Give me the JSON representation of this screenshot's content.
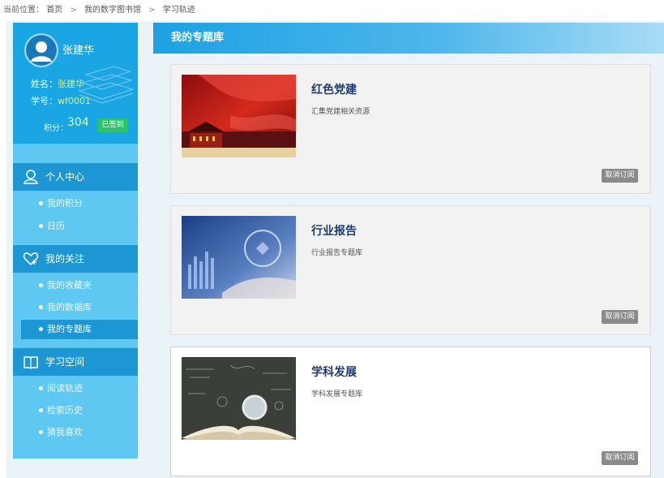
{
  "breadcrumb": {
    "prefix": "当前位置：",
    "items": [
      "首页",
      "我的数字图书馆",
      "学习轨迹"
    ],
    "separator": ">"
  },
  "profile": {
    "name": "张建华",
    "name_label": "姓名：",
    "name_value": "张建华",
    "id_label": "学号：",
    "id_value": "wf0001",
    "score_label": "积分：",
    "score_value": "304",
    "checkin_label": "已签到"
  },
  "sidebar": {
    "groups": [
      {
        "title": "个人中心",
        "icon": "person-icon",
        "items": [
          "我的积分",
          "日历"
        ]
      },
      {
        "title": "我的关注",
        "icon": "heart-plus-icon",
        "items": [
          "我的收藏夹",
          "我的数据库",
          "我的专题库"
        ]
      },
      {
        "title": "学习空间",
        "icon": "book-icon",
        "items": [
          "阅读轨迹",
          "检索历史",
          "猜我喜欢"
        ]
      }
    ],
    "active_item": "我的专题库"
  },
  "main": {
    "title": "我的专题库",
    "cards": [
      {
        "title": "红色党建",
        "desc": "汇集党建相关资源",
        "button": "取消订阅"
      },
      {
        "title": "行业报告",
        "desc": "行业报告专题库",
        "button": "取消订阅"
      },
      {
        "title": "学科发展",
        "desc": "学科发展专题库",
        "button": "取消订阅"
      }
    ]
  },
  "colors": {
    "sidebar_bg": "#5ec8f2",
    "sidebar_dark": "#1d97d4",
    "profile_bg": "#1aa5e4",
    "checkin_green": "#2bc36b",
    "title_navy": "#1e3a6e",
    "unsub_gray": "#8a8a8a"
  }
}
